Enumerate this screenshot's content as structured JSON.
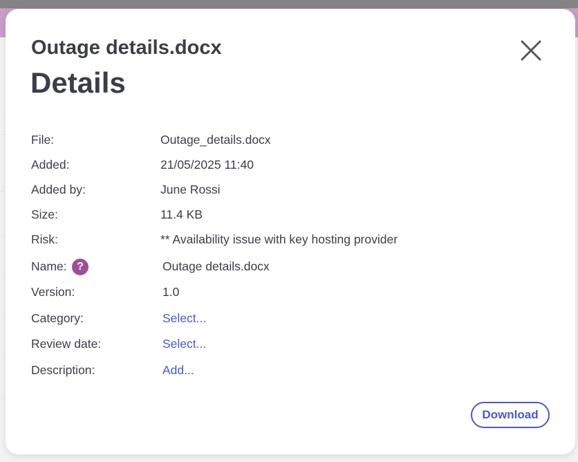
{
  "dialog": {
    "file_title": "Outage details.docx",
    "heading": "Details",
    "close_icon": "close-icon",
    "download_label": "Download",
    "fields": {
      "file": {
        "label": "File:",
        "value": "Outage_details.docx"
      },
      "added": {
        "label": "Added:",
        "value": "21/05/2025 11:40"
      },
      "added_by": {
        "label": "Added by:",
        "value": "June Rossi"
      },
      "size": {
        "label": "Size:",
        "value": "11.4 KB"
      },
      "risk": {
        "label": "Risk:",
        "value": "** Availability issue with key hosting provider"
      },
      "name": {
        "label": "Name:",
        "value": "Outage details.docx",
        "help_icon": "question-icon",
        "help_symbol": "?"
      },
      "version": {
        "label": "Version:",
        "value": "1.0"
      },
      "category": {
        "label": "Category:",
        "value": "Select..."
      },
      "review_date": {
        "label": "Review date:",
        "value": "Select..."
      },
      "description": {
        "label": "Description:",
        "value": "Add..."
      }
    }
  },
  "colors": {
    "accent": "#9b4f97",
    "link": "#4a58c9",
    "text": "#3c3e47"
  }
}
